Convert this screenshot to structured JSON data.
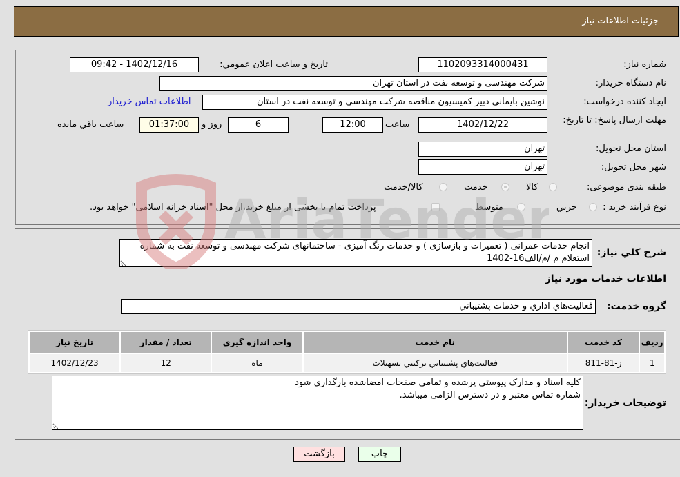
{
  "header": {
    "title": "جزئیات اطلاعات نیاز"
  },
  "form": {
    "need_number": {
      "label": "شماره نیاز:",
      "value": "1102093314000431"
    },
    "announce_datetime": {
      "label": "تاريخ و ساعت اعلان عمومي:",
      "value": "1402/12/16 - 09:42"
    },
    "buyer_org": {
      "label": "نام دستگاه خريدار:",
      "value": "شرکت مهندسی و توسعه نفت در استان تهران"
    },
    "requester": {
      "label": "ايجاد کننده درخواست:",
      "value": "نوشین بایمانی دبیر کمیسیون مناقصه شرکت مهندسی و توسعه نفت در استان"
    },
    "buyer_contact_link": "اطلاعات تماس خريدار",
    "deadline": {
      "label": "مهلت ارسال پاسخ: تا تاريخ:",
      "date": "1402/12/22",
      "time_label": "ساعت",
      "time": "12:00",
      "days": "6",
      "days_label": "روز و",
      "remaining": "01:37:00",
      "remaining_label": "ساعت باقي مانده"
    },
    "province": {
      "label": "استان محل تحويل:",
      "value": "تهران"
    },
    "city": {
      "label": "شهر محل تحويل:",
      "value": "تهران"
    },
    "category": {
      "label": "طبقه بندی موضوعی:",
      "options": [
        "کالا",
        "خدمت",
        "کالا/خدمت"
      ],
      "selected": "خدمت"
    },
    "purchase_type": {
      "label": "نوع فرآيند خريد :",
      "options": [
        "جزيي",
        "متوسط"
      ],
      "note": "پرداخت تمام يا بخشی از مبلغ خريد،از محل \"اسناد خزانه اسلامی\" خواهد بود."
    }
  },
  "description": {
    "label": "شرح کلي نياز:",
    "value": "انجام خدمات عمرانی ( تعمیرات و بازسازی ) و خدمات رنگ آمیزی - ساختمانهای شرکت مهندسی و توسعه نفت به شماره استعلام م /م/الف16-1402"
  },
  "services_section": {
    "title": "اطلاعات خدمات مورد نياز",
    "group_label": "گروه خدمت:",
    "group_value": "فعاليت‌هاي اداري و خدمات پشتيباني",
    "table": {
      "headers": [
        "رديف",
        "کد خدمت",
        "نام خدمت",
        "واحد اندازه گيری",
        "تعداد / مقدار",
        "تاريخ نياز"
      ],
      "rows": [
        [
          "1",
          "ز-81-811",
          "فعاليت‌هاي پشتيباني ترکيبي تسهيلات",
          "ماه",
          "12",
          "1402/12/23"
        ]
      ]
    }
  },
  "buyer_notes": {
    "label": "توضيحات خريدار:",
    "value": "کلیه اسناد و مدارک پیوستی پرشده و تمامی صفحات امضاشده بارگذاری شود\nشماره تماس معتبر و در دسترس الزامی میباشد."
  },
  "buttons": {
    "print": "چاپ",
    "back": "بازگشت"
  },
  "watermark": {
    "text": "AriaTender.neT"
  },
  "colors": {
    "header_bg": "#8b6d43",
    "link": "#1a1ad0",
    "back_btn": "#ffe0e0",
    "print_btn": "#eaffea"
  }
}
